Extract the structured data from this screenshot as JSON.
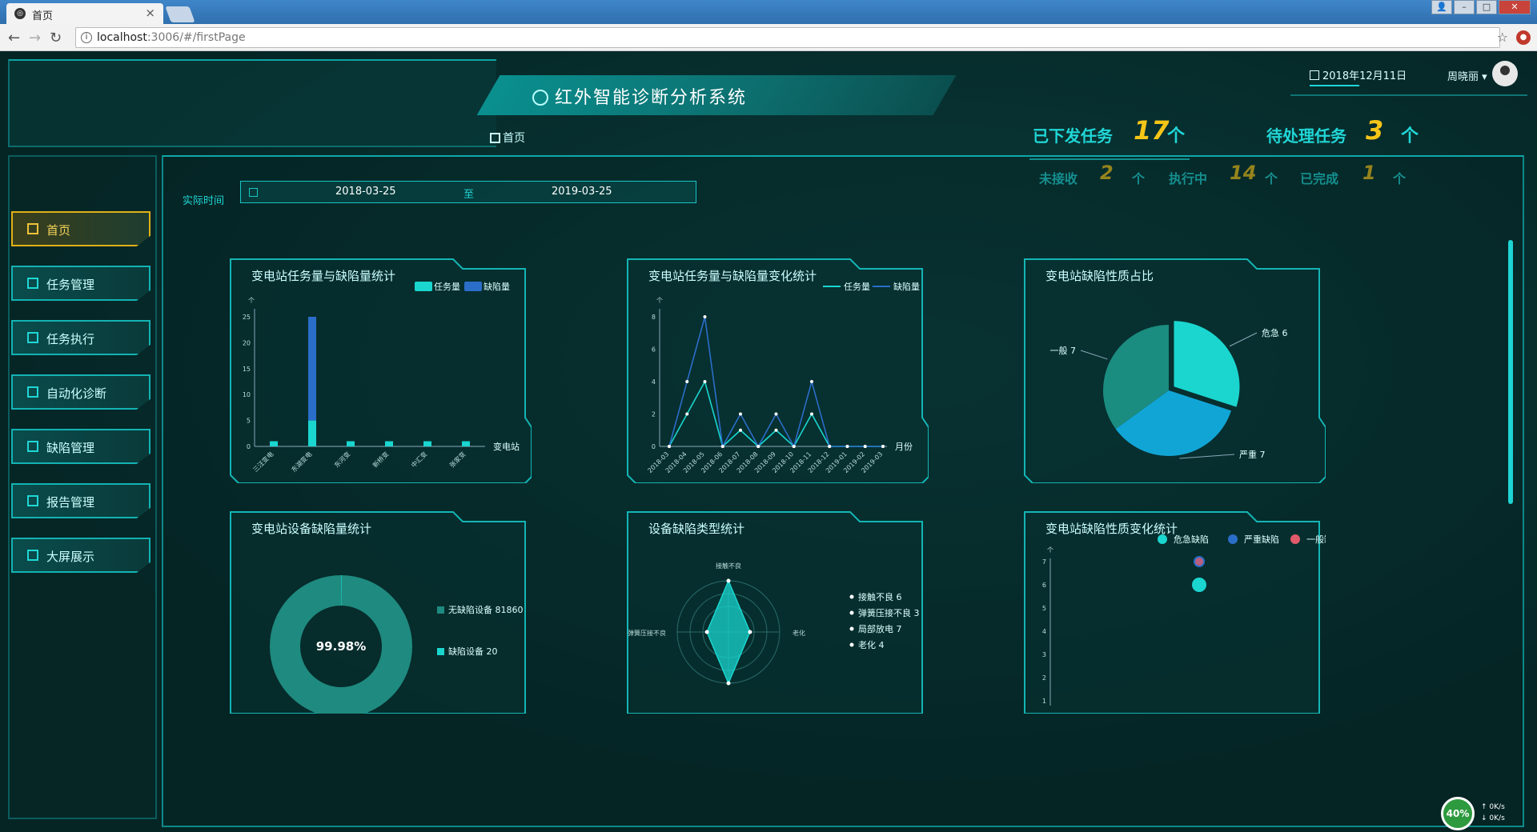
{
  "browser": {
    "tab_title": "首页",
    "tab_icon": "tab-favicon",
    "url_host": "localhost",
    "url_path": ":3006/#/firstPage"
  },
  "header": {
    "system_title": "红外智能诊断分析系统",
    "breadcrumb": "首页",
    "date": "2018年12月11日",
    "user_name": "周晓丽"
  },
  "tasks": {
    "issued_label": "已下发任务",
    "issued_value": "17",
    "pending_label": "待处理任务",
    "pending_value": "3",
    "unit": "个",
    "not_received_label": "未接收",
    "not_received_value": "2",
    "executing_label": "执行中",
    "executing_value": "14",
    "completed_label": "已完成",
    "completed_value": "1",
    "arrow": "个"
  },
  "sidebar": {
    "items": [
      {
        "label": "首页",
        "active": true
      },
      {
        "label": "任务管理"
      },
      {
        "label": "任务执行"
      },
      {
        "label": "自动化诊断"
      },
      {
        "label": "缺陷管理"
      },
      {
        "label": "报告管理"
      },
      {
        "label": "大屏展示"
      }
    ]
  },
  "filter": {
    "label": "实际时间",
    "start": "2018-03-25",
    "sep": "至",
    "end": "2019-03-25"
  },
  "cards": {
    "c1_title": "变电站任务量与缺陷量统计",
    "c2_title": "变电站任务量与缺陷量变化统计",
    "c3_title": "变电站缺陷性质占比",
    "c4_title": "变电站设备缺陷量统计",
    "c5_title": "设备缺陷类型统计",
    "c6_title": "变电站缺陷性质变化统计"
  },
  "colors": {
    "teal": "#1ad6cf",
    "blue": "#2b6ec9",
    "red": "#e05a6a",
    "accent": "#21d6d6",
    "yellow": "#f5c518"
  },
  "chart_data": [
    {
      "type": "bar",
      "title": "变电站任务量与缺陷量统计",
      "xlabel": "变电站",
      "ylabel": "个",
      "ylim": [
        0,
        25
      ],
      "yticks": [
        0,
        5,
        10,
        15,
        20,
        25
      ],
      "categories": [
        "三汪变电",
        "东湖变电",
        "东河变",
        "新桥变",
        "中汇变",
        "张家变"
      ],
      "series": [
        {
          "name": "任务量",
          "values": [
            1,
            5,
            1,
            1,
            1,
            1
          ]
        },
        {
          "name": "缺陷量",
          "values": [
            0,
            20,
            0,
            0,
            0,
            0
          ]
        }
      ],
      "stacked": true,
      "legend": "top-right"
    },
    {
      "type": "line",
      "title": "变电站任务量与缺陷量变化统计",
      "xlabel": "月份",
      "ylabel": "个",
      "ylim": [
        0,
        8
      ],
      "yticks": [
        0,
        2,
        4,
        6,
        8
      ],
      "categories": [
        "2018-03",
        "2018-04",
        "2018-05",
        "2018-06",
        "2018-07",
        "2018-08",
        "2018-09",
        "2018-10",
        "2018-11",
        "2018-12",
        "2019-01",
        "2019-02",
        "2019-03"
      ],
      "series": [
        {
          "name": "任务量",
          "values": [
            0,
            2,
            4,
            0,
            1,
            0,
            1,
            0,
            2,
            0,
            0,
            0,
            0
          ]
        },
        {
          "name": "缺陷量",
          "values": [
            0,
            4,
            8,
            0,
            2,
            0,
            2,
            0,
            4,
            0,
            0,
            0,
            0
          ]
        }
      ],
      "legend": "top-right"
    },
    {
      "type": "pie",
      "title": "变电站缺陷性质占比",
      "slices": [
        {
          "label": "危急",
          "value": 6
        },
        {
          "label": "严重",
          "value": 7
        },
        {
          "label": "一般",
          "value": 7
        }
      ]
    },
    {
      "type": "pie",
      "title": "变电站设备缺陷量统计",
      "center_label": "99.98%",
      "slices": [
        {
          "label": "无缺陷设备",
          "value": 81860
        },
        {
          "label": "缺陷设备",
          "value": 20
        }
      ]
    },
    {
      "type": "radar",
      "title": "设备缺陷类型统计",
      "axes": [
        "接触不良",
        "老化",
        "局部放电",
        "弹簧压接不良"
      ],
      "legend_items": [
        {
          "label": "接触不良",
          "value": 6
        },
        {
          "label": "弹簧压接不良",
          "value": 3
        },
        {
          "label": "局部放电",
          "value": 7
        },
        {
          "label": "老化",
          "value": 4
        }
      ]
    },
    {
      "type": "scatter",
      "title": "变电站缺陷性质变化统计",
      "ylabel": "个",
      "ylim": [
        1,
        7
      ],
      "yticks": [
        1,
        2,
        3,
        4,
        5,
        6,
        7
      ],
      "series": [
        {
          "name": "危急缺陷",
          "points": [
            [
              0.5,
              6
            ]
          ]
        },
        {
          "name": "严重缺陷",
          "points": [
            [
              0.5,
              7
            ]
          ]
        },
        {
          "name": "一般缺陷",
          "points": [
            [
              0.5,
              7
            ]
          ]
        }
      ],
      "legend": "top-right"
    }
  ],
  "tray": {
    "percent": "40%",
    "up": "0K/s",
    "down": "0K/s"
  }
}
